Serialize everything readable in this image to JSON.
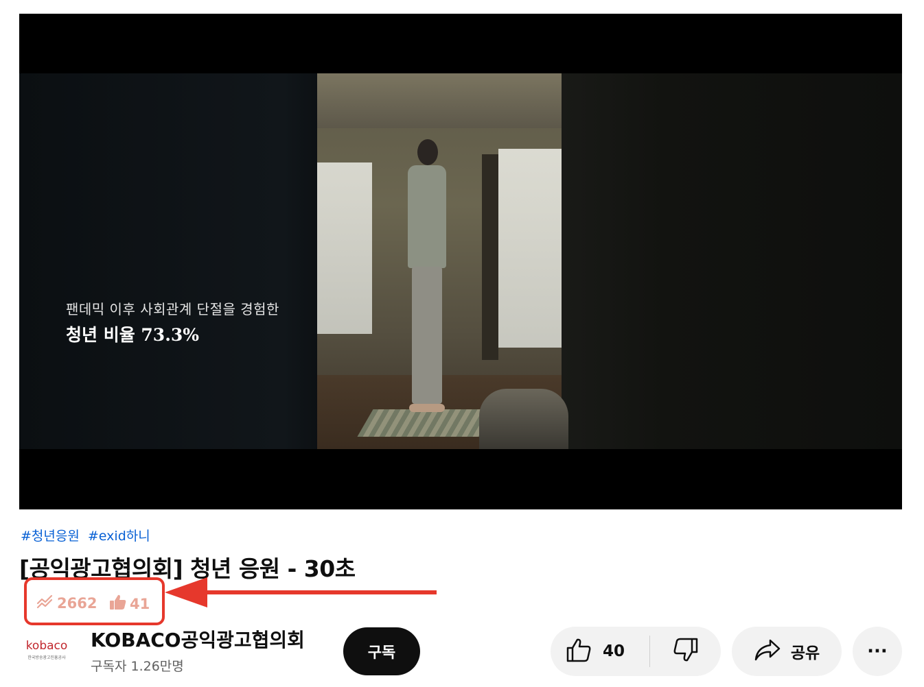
{
  "video": {
    "overlay_line1": "팬데믹 이후 사회관계 단절을 경험한",
    "overlay_line2": "청년 비율 73.3%"
  },
  "hashtags": [
    "#청년응원",
    "#exid하니"
  ],
  "title": "[공익광고협의회] 청년 응원 - 30초",
  "stats": {
    "views": "2662",
    "likes": "41"
  },
  "channel": {
    "logo_text": "kobaco",
    "logo_subtext": "한국방송광고진흥공사",
    "name": "KOBACO공익광고협의회",
    "subscribers": "구독자 1.26만명"
  },
  "actions": {
    "subscribe_label": "구독",
    "like_count": "40",
    "share_label": "공유",
    "more_label": "···"
  },
  "colors": {
    "accent_red": "#e6382c",
    "stat_pink": "#e9a596",
    "hashtag_blue": "#065fd4",
    "button_gray": "#f2f2f2"
  },
  "icons": [
    "trending-icon",
    "thumbs-up-icon",
    "like-icon",
    "dislike-icon",
    "share-icon",
    "more-icon"
  ]
}
